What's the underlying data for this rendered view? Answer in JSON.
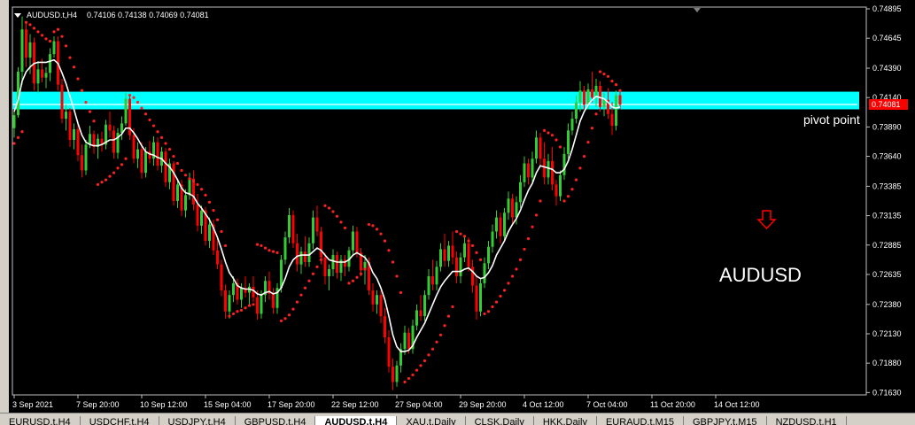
{
  "header": {
    "menu_icon": "triangle-down-icon",
    "symbol": "AUDUSD.t,H4",
    "ohlc": "0.74106 0.74138 0.74069 0.74081"
  },
  "annotations": {
    "pivot_label": "pivot point",
    "symbol_label": "AUDUSD",
    "arrow_icon": "down-arrow-icon",
    "price_tag": "0.74081"
  },
  "colors": {
    "background": "#000000",
    "bull": "#32cd32",
    "bear": "#ff0000",
    "ma": "#ffffff",
    "sar": "#ff2020",
    "pivot_band": "#00ffff",
    "arrow": "#ff0000"
  },
  "tabs": [
    {
      "label": "EURUSD.t,H4",
      "active": false
    },
    {
      "label": "USDCHF.t,H4",
      "active": false
    },
    {
      "label": "USDJPY.t,H4",
      "active": false
    },
    {
      "label": "GBPUSD.t,H4",
      "active": false
    },
    {
      "label": "AUDUSD.t,H4",
      "active": true
    },
    {
      "label": "XAU.t,Daily",
      "active": false
    },
    {
      "label": "CLSK,Daily",
      "active": false
    },
    {
      "label": "HKK,Daily",
      "active": false
    },
    {
      "label": "EURAUD.t,M15",
      "active": false
    },
    {
      "label": "GBPJPY.t,M15",
      "active": false
    },
    {
      "label": "NZDUSD.t,H1",
      "active": false
    }
  ],
  "chart_data": {
    "type": "candlestick",
    "symbol": "AUDUSD",
    "timeframe": "H4",
    "y_ticks": [
      0.74895,
      0.74645,
      0.7439,
      0.7414,
      0.7389,
      0.7364,
      0.73385,
      0.73135,
      0.72885,
      0.72635,
      0.7238,
      0.7213,
      0.7188,
      0.7163
    ],
    "ylim": [
      0.7161,
      0.7491
    ],
    "x_labels": [
      "3 Sep 2021",
      "7 Sep 20:00",
      "10 Sep 12:00",
      "15 Sep 04:00",
      "17 Sep 20:00",
      "22 Sep 12:00",
      "27 Sep 04:00",
      "29 Sep 20:00",
      "4 Oct 12:00",
      "7 Oct 04:00",
      "11 Oct 20:00",
      "14 Oct 12:00"
    ],
    "x_label_index": [
      0,
      16,
      32,
      48,
      64,
      80,
      96,
      112,
      128,
      144,
      160,
      176
    ],
    "pivot_band": [
      0.7404,
      0.7419
    ],
    "current_price": 0.74081,
    "candles": [
      [
        0.7388,
        0.7402,
        0.738,
        0.7399
      ],
      [
        0.7399,
        0.744,
        0.7397,
        0.7436
      ],
      [
        0.7436,
        0.7483,
        0.7425,
        0.7472
      ],
      [
        0.7472,
        0.7478,
        0.744,
        0.7448
      ],
      [
        0.7448,
        0.7468,
        0.7434,
        0.7461
      ],
      [
        0.7461,
        0.7465,
        0.742,
        0.7426
      ],
      [
        0.7426,
        0.7445,
        0.7418,
        0.7438
      ],
      [
        0.7438,
        0.7447,
        0.7427,
        0.7431
      ],
      [
        0.7431,
        0.744,
        0.7422,
        0.7435
      ],
      [
        0.7435,
        0.7456,
        0.7428,
        0.7451
      ],
      [
        0.7451,
        0.7466,
        0.7448,
        0.7462
      ],
      [
        0.7462,
        0.7466,
        0.742,
        0.7425
      ],
      [
        0.7425,
        0.743,
        0.7392,
        0.7396
      ],
      [
        0.7396,
        0.7408,
        0.7386,
        0.7402
      ],
      [
        0.7402,
        0.7405,
        0.7372,
        0.7378
      ],
      [
        0.7378,
        0.7392,
        0.737,
        0.7387
      ],
      [
        0.7387,
        0.7394,
        0.736,
        0.7365
      ],
      [
        0.7365,
        0.7374,
        0.7346,
        0.7352
      ],
      [
        0.7352,
        0.7378,
        0.7348,
        0.7374
      ],
      [
        0.7374,
        0.739,
        0.7371,
        0.7383
      ],
      [
        0.7383,
        0.7386,
        0.7366,
        0.7372
      ],
      [
        0.7372,
        0.7383,
        0.7362,
        0.7379
      ],
      [
        0.7379,
        0.7385,
        0.7368,
        0.7374
      ],
      [
        0.7374,
        0.7395,
        0.737,
        0.7391
      ],
      [
        0.7391,
        0.7402,
        0.738,
        0.7386
      ],
      [
        0.7386,
        0.739,
        0.7362,
        0.7367
      ],
      [
        0.7367,
        0.7388,
        0.7362,
        0.7384
      ],
      [
        0.7384,
        0.7398,
        0.7378,
        0.7392
      ],
      [
        0.7392,
        0.7418,
        0.739,
        0.7413
      ],
      [
        0.7413,
        0.7416,
        0.7378,
        0.7382
      ],
      [
        0.7382,
        0.7388,
        0.7358,
        0.7362
      ],
      [
        0.7362,
        0.7376,
        0.7354,
        0.737
      ],
      [
        0.737,
        0.7376,
        0.7345,
        0.735
      ],
      [
        0.735,
        0.7372,
        0.7346,
        0.7368
      ],
      [
        0.7368,
        0.7377,
        0.7358,
        0.7362
      ],
      [
        0.7362,
        0.7381,
        0.7356,
        0.7376
      ],
      [
        0.7376,
        0.738,
        0.7352,
        0.7356
      ],
      [
        0.7356,
        0.7372,
        0.735,
        0.7368
      ],
      [
        0.7368,
        0.7371,
        0.7338,
        0.7342
      ],
      [
        0.7342,
        0.7362,
        0.7336,
        0.7358
      ],
      [
        0.7358,
        0.736,
        0.7322,
        0.7326
      ],
      [
        0.7326,
        0.7345,
        0.732,
        0.734
      ],
      [
        0.734,
        0.7344,
        0.7313,
        0.7318
      ],
      [
        0.7318,
        0.7336,
        0.7312,
        0.7331
      ],
      [
        0.7331,
        0.735,
        0.7327,
        0.7345
      ],
      [
        0.7345,
        0.7352,
        0.7318,
        0.7323
      ],
      [
        0.7323,
        0.7332,
        0.73,
        0.7305
      ],
      [
        0.7305,
        0.7322,
        0.7298,
        0.7318
      ],
      [
        0.7318,
        0.7321,
        0.7288,
        0.7292
      ],
      [
        0.7292,
        0.7312,
        0.7286,
        0.7306
      ],
      [
        0.7306,
        0.731,
        0.728,
        0.7284
      ],
      [
        0.7284,
        0.7296,
        0.7268,
        0.7272
      ],
      [
        0.7272,
        0.7276,
        0.7245,
        0.725
      ],
      [
        0.725,
        0.7255,
        0.7226,
        0.7232
      ],
      [
        0.7232,
        0.725,
        0.7226,
        0.7246
      ],
      [
        0.7246,
        0.7262,
        0.724,
        0.7256
      ],
      [
        0.7256,
        0.726,
        0.7238,
        0.7242
      ],
      [
        0.7242,
        0.7256,
        0.7235,
        0.7252
      ],
      [
        0.7252,
        0.7262,
        0.7244,
        0.7248
      ],
      [
        0.7248,
        0.7256,
        0.7236,
        0.7253
      ],
      [
        0.7253,
        0.7262,
        0.724,
        0.7244
      ],
      [
        0.7244,
        0.725,
        0.7225,
        0.723
      ],
      [
        0.723,
        0.725,
        0.7226,
        0.7246
      ],
      [
        0.7246,
        0.7262,
        0.724,
        0.7258
      ],
      [
        0.7258,
        0.7266,
        0.7242,
        0.7247
      ],
      [
        0.7247,
        0.7252,
        0.723,
        0.7235
      ],
      [
        0.7235,
        0.7256,
        0.723,
        0.7252
      ],
      [
        0.7252,
        0.728,
        0.7248,
        0.7276
      ],
      [
        0.7276,
        0.73,
        0.7272,
        0.7295
      ],
      [
        0.7295,
        0.732,
        0.729,
        0.7314
      ],
      [
        0.7314,
        0.7318,
        0.7286,
        0.729
      ],
      [
        0.729,
        0.7298,
        0.7266,
        0.7272
      ],
      [
        0.7272,
        0.7287,
        0.7264,
        0.7283
      ],
      [
        0.7283,
        0.7296,
        0.727,
        0.7274
      ],
      [
        0.7274,
        0.7295,
        0.727,
        0.729
      ],
      [
        0.729,
        0.7318,
        0.7285,
        0.7312
      ],
      [
        0.7312,
        0.7322,
        0.7296,
        0.73
      ],
      [
        0.73,
        0.7304,
        0.7272,
        0.7278
      ],
      [
        0.7278,
        0.7282,
        0.7255,
        0.7262
      ],
      [
        0.7262,
        0.7272,
        0.725,
        0.7268
      ],
      [
        0.7268,
        0.7285,
        0.7262,
        0.728
      ],
      [
        0.728,
        0.7283,
        0.726,
        0.7265
      ],
      [
        0.7265,
        0.728,
        0.7258,
        0.7276
      ],
      [
        0.7276,
        0.728,
        0.7262,
        0.727
      ],
      [
        0.727,
        0.7287,
        0.7266,
        0.7284
      ],
      [
        0.7284,
        0.7305,
        0.728,
        0.73
      ],
      [
        0.73,
        0.7304,
        0.7278,
        0.7282
      ],
      [
        0.7282,
        0.7286,
        0.7262,
        0.7267
      ],
      [
        0.7267,
        0.728,
        0.7255,
        0.7274
      ],
      [
        0.7274,
        0.7278,
        0.7246,
        0.725
      ],
      [
        0.725,
        0.7256,
        0.7232,
        0.7238
      ],
      [
        0.7238,
        0.725,
        0.723,
        0.7246
      ],
      [
        0.7246,
        0.725,
        0.7222,
        0.7228
      ],
      [
        0.7228,
        0.7235,
        0.7205,
        0.721
      ],
      [
        0.721,
        0.7216,
        0.718,
        0.7185
      ],
      [
        0.7185,
        0.7192,
        0.7165,
        0.7172
      ],
      [
        0.7172,
        0.719,
        0.7168,
        0.7186
      ],
      [
        0.7186,
        0.7205,
        0.718,
        0.72
      ],
      [
        0.72,
        0.722,
        0.7195,
        0.7214
      ],
      [
        0.7214,
        0.7218,
        0.7196,
        0.72
      ],
      [
        0.72,
        0.7225,
        0.7196,
        0.722
      ],
      [
        0.722,
        0.7238,
        0.7216,
        0.7233
      ],
      [
        0.7233,
        0.7246,
        0.7224,
        0.7228
      ],
      [
        0.7228,
        0.725,
        0.7224,
        0.7246
      ],
      [
        0.7246,
        0.7268,
        0.7242,
        0.7262
      ],
      [
        0.7262,
        0.7276,
        0.725,
        0.7255
      ],
      [
        0.7255,
        0.7275,
        0.725,
        0.727
      ],
      [
        0.727,
        0.729,
        0.7266,
        0.7285
      ],
      [
        0.7285,
        0.7298,
        0.727,
        0.7275
      ],
      [
        0.7275,
        0.7292,
        0.727,
        0.7288
      ],
      [
        0.7288,
        0.73,
        0.7272,
        0.7278
      ],
      [
        0.7278,
        0.7283,
        0.7256,
        0.7262
      ],
      [
        0.7262,
        0.7282,
        0.7256,
        0.7278
      ],
      [
        0.7278,
        0.7296,
        0.7274,
        0.729
      ],
      [
        0.729,
        0.7295,
        0.7266,
        0.727
      ],
      [
        0.727,
        0.7276,
        0.7248,
        0.7254
      ],
      [
        0.7254,
        0.7262,
        0.7225,
        0.7232
      ],
      [
        0.7232,
        0.726,
        0.7228,
        0.7256
      ],
      [
        0.7256,
        0.7278,
        0.7252,
        0.7273
      ],
      [
        0.7273,
        0.7292,
        0.7268,
        0.7287
      ],
      [
        0.7287,
        0.7306,
        0.7282,
        0.73
      ],
      [
        0.73,
        0.7318,
        0.7294,
        0.7312
      ],
      [
        0.7312,
        0.7316,
        0.729,
        0.7296
      ],
      [
        0.7296,
        0.732,
        0.7292,
        0.7316
      ],
      [
        0.7316,
        0.7334,
        0.731,
        0.7328
      ],
      [
        0.7328,
        0.7332,
        0.7305,
        0.7312
      ],
      [
        0.7312,
        0.733,
        0.7306,
        0.7325
      ],
      [
        0.7325,
        0.7348,
        0.732,
        0.7342
      ],
      [
        0.7342,
        0.7364,
        0.7338,
        0.7358
      ],
      [
        0.7358,
        0.7362,
        0.734,
        0.7346
      ],
      [
        0.7346,
        0.7368,
        0.7342,
        0.7362
      ],
      [
        0.7362,
        0.7386,
        0.7358,
        0.738
      ],
      [
        0.738,
        0.7384,
        0.7356,
        0.7362
      ],
      [
        0.7362,
        0.7376,
        0.734,
        0.7346
      ],
      [
        0.7346,
        0.7366,
        0.734,
        0.736
      ],
      [
        0.736,
        0.7372,
        0.7335,
        0.734
      ],
      [
        0.734,
        0.7344,
        0.7322,
        0.733
      ],
      [
        0.733,
        0.7352,
        0.7326,
        0.7348
      ],
      [
        0.7348,
        0.7372,
        0.7344,
        0.7366
      ],
      [
        0.7366,
        0.7392,
        0.7362,
        0.7386
      ],
      [
        0.7386,
        0.7402,
        0.7382,
        0.7396
      ],
      [
        0.7396,
        0.7416,
        0.7392,
        0.741
      ],
      [
        0.741,
        0.7428,
        0.7402,
        0.742
      ],
      [
        0.742,
        0.7424,
        0.7404,
        0.7408
      ],
      [
        0.7408,
        0.7426,
        0.7404,
        0.7421
      ],
      [
        0.7421,
        0.7436,
        0.741,
        0.7414
      ],
      [
        0.7414,
        0.743,
        0.7406,
        0.7424
      ],
      [
        0.7424,
        0.7428,
        0.7402,
        0.7406
      ],
      [
        0.7406,
        0.7418,
        0.7398,
        0.7412
      ],
      [
        0.7412,
        0.7422,
        0.7396,
        0.74
      ],
      [
        0.74,
        0.741,
        0.7382,
        0.739
      ],
      [
        0.739,
        0.742,
        0.7386,
        0.7416
      ],
      [
        0.7416,
        0.742,
        0.7404,
        0.7408
      ]
    ],
    "ma_line": [
      0.7402,
      0.7412,
      0.7428,
      0.7436,
      0.744,
      0.7443,
      0.7444,
      0.7444,
      0.7444,
      0.7445,
      0.7446,
      0.7443,
      0.7435,
      0.7426,
      0.7415,
      0.7404,
      0.7392,
      0.7382,
      0.7376,
      0.7374,
      0.7373,
      0.7373,
      0.7374,
      0.7376,
      0.7378,
      0.7378,
      0.738,
      0.7383,
      0.7388,
      0.7388,
      0.7384,
      0.7379,
      0.7373,
      0.7368,
      0.7366,
      0.7365,
      0.7363,
      0.7362,
      0.7358,
      0.7355,
      0.735,
      0.7344,
      0.7337,
      0.7333,
      0.7332,
      0.733,
      0.7324,
      0.732,
      0.7315,
      0.731,
      0.7303,
      0.7295,
      0.7285,
      0.7274,
      0.7265,
      0.726,
      0.7254,
      0.7252,
      0.7251,
      0.7251,
      0.725,
      0.7247,
      0.7246,
      0.7248,
      0.7249,
      0.7247,
      0.7248,
      0.7252,
      0.726,
      0.727,
      0.7276,
      0.7279,
      0.728,
      0.728,
      0.728,
      0.7283,
      0.7286,
      0.7284,
      0.728,
      0.7276,
      0.7275,
      0.7274,
      0.7274,
      0.7274,
      0.7276,
      0.728,
      0.7282,
      0.728,
      0.7278,
      0.7273,
      0.7265,
      0.726,
      0.7252,
      0.7242,
      0.7228,
      0.7212,
      0.7202,
      0.7198,
      0.7198,
      0.7199,
      0.7203,
      0.721,
      0.7216,
      0.7222,
      0.723,
      0.7238,
      0.7246,
      0.7253,
      0.7258,
      0.7262,
      0.7266,
      0.7266,
      0.7266,
      0.7268,
      0.7269,
      0.7266,
      0.7262,
      0.726,
      0.7261,
      0.7265,
      0.7271,
      0.728,
      0.7286,
      0.7292,
      0.73,
      0.7306,
      0.7311,
      0.7318,
      0.7327,
      0.7335,
      0.7341,
      0.735,
      0.7356,
      0.7355,
      0.7354,
      0.7353,
      0.735,
      0.735,
      0.7353,
      0.736,
      0.737,
      0.7382,
      0.7394,
      0.7402,
      0.7408,
      0.7412,
      0.7415,
      0.7414,
      0.7413,
      0.741,
      0.7406,
      0.7405,
      0.7406
    ],
    "sar_points": [
      0.7375,
      0.738,
      0.7385,
      0.7478,
      0.7476,
      0.7473,
      0.747,
      0.7467,
      0.7464,
      0.7462,
      0.747,
      0.7472,
      0.7466,
      0.7458,
      0.7448,
      0.744,
      0.743,
      0.742,
      0.741,
      0.7402,
      0.7394,
      0.734,
      0.7342,
      0.7344,
      0.7347,
      0.735,
      0.7354,
      0.7357,
      0.7362,
      0.7416,
      0.7414,
      0.741,
      0.7405,
      0.74,
      0.7395,
      0.739,
      0.7385,
      0.738,
      0.7375,
      0.737,
      0.7364,
      0.7358,
      0.7352,
      0.7348,
      0.7345,
      0.7343,
      0.734,
      0.7336,
      0.7331,
      0.7325,
      0.7318,
      0.731,
      0.73,
      0.7288,
      0.7228,
      0.723,
      0.7232,
      0.7233,
      0.7235,
      0.7237,
      0.7238,
      0.7289,
      0.7288,
      0.7286,
      0.7284,
      0.7283,
      0.7282,
      0.7224,
      0.7226,
      0.7229,
      0.7234,
      0.724,
      0.7246,
      0.7252,
      0.7258,
      0.7264,
      0.727,
      0.7276,
      0.7322,
      0.732,
      0.7317,
      0.7313,
      0.7308,
      0.7303,
      0.7256,
      0.7258,
      0.7261,
      0.7264,
      0.7268,
      0.7306,
      0.7305,
      0.7302,
      0.7298,
      0.7292,
      0.7284,
      0.7274,
      0.7262,
      0.7248,
      0.7172,
      0.7175,
      0.7178,
      0.7182,
      0.7186,
      0.719,
      0.7195,
      0.72,
      0.7206,
      0.7212,
      0.722,
      0.7228,
      0.7236,
      0.73,
      0.7298,
      0.7296,
      0.7292,
      0.7288,
      0.7282,
      0.7276,
      0.723,
      0.7232,
      0.7236,
      0.724,
      0.7245,
      0.725,
      0.7256,
      0.7262,
      0.7268,
      0.7276,
      0.7285,
      0.7294,
      0.7304,
      0.7314,
      0.7326,
      0.7386,
      0.7384,
      0.7382,
      0.7378,
      0.7372,
      0.7326,
      0.733,
      0.7336,
      0.7344,
      0.7354,
      0.7364,
      0.7376,
      0.7388,
      0.74,
      0.7436,
      0.7434,
      0.7432,
      0.7428,
      0.7425,
      0.742
    ]
  }
}
